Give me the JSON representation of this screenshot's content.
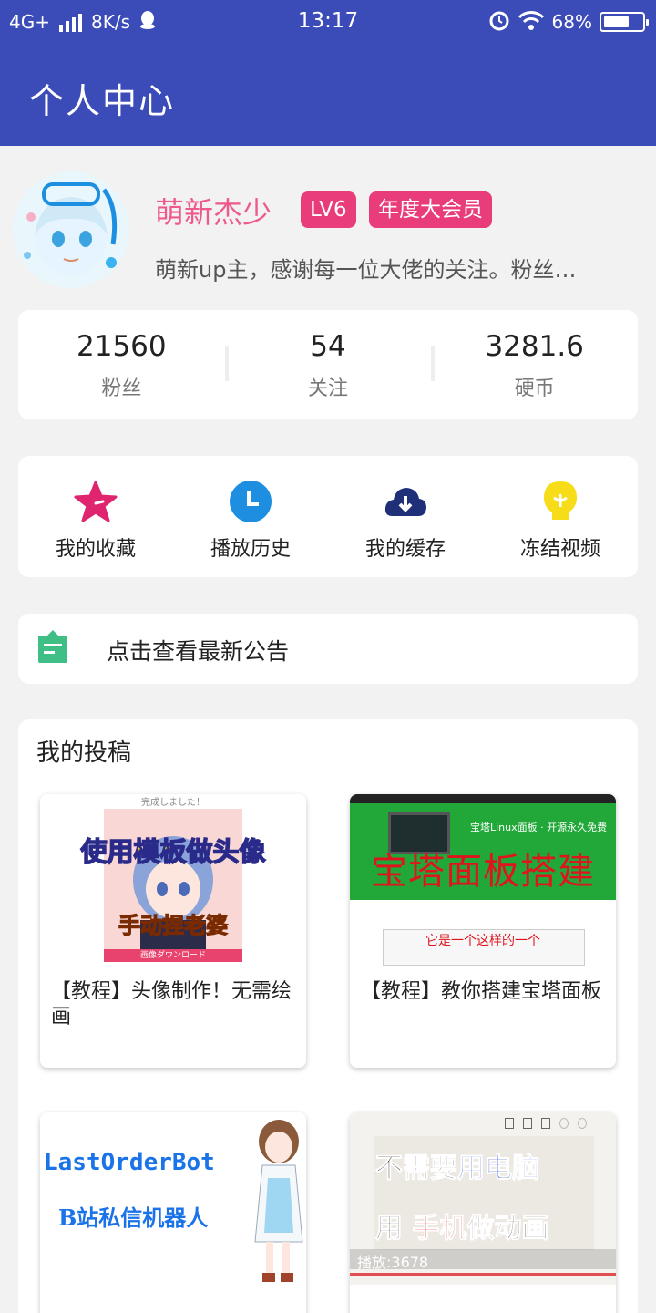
{
  "status_bar": {
    "network": "4G+",
    "speed": "8K/s",
    "time": "13:17",
    "battery": "68%",
    "battery_level": 0.68,
    "icons": [
      "signal-icon",
      "qq-icon",
      "alarm-icon",
      "wifi-icon",
      "battery-icon"
    ]
  },
  "appbar": {
    "title": "个人中心"
  },
  "profile": {
    "username": "萌新杰少",
    "level_badge": "LV6",
    "vip_badge": "年度大会员",
    "bio": "萌新up主，感谢每一位大佬的关注。粉丝…"
  },
  "stats": [
    {
      "value": "21560",
      "label": "粉丝"
    },
    {
      "value": "54",
      "label": "关注"
    },
    {
      "value": "3281.6",
      "label": "硬币"
    }
  ],
  "quick_actions": [
    {
      "label": "我的收藏",
      "icon": "star-icon",
      "color": "#e0256f"
    },
    {
      "label": "播放历史",
      "icon": "clock-icon",
      "color": "#1e8fe0"
    },
    {
      "label": "我的缓存",
      "icon": "cloud-download-icon",
      "color": "#1f2f78"
    },
    {
      "label": "冻结视频",
      "icon": "bulb-icon",
      "color": "#f7dc1a"
    }
  ],
  "notice": {
    "text": "点击查看最新公告",
    "icon": "notice-icon",
    "color": "#3fbf86"
  },
  "posts": {
    "title": "我的投稿",
    "items": [
      {
        "title": "【教程】头像制作！无需绘画",
        "thumb": {
          "top_caption": "完成しました！",
          "headline": "使用模板做头像",
          "sub": "手动捏老婆",
          "button": "画像ダウンロード"
        }
      },
      {
        "title": "【教程】教你搭建宝塔面板",
        "thumb": {
          "banner": "宝塔Linux面板 · 开源永久免费",
          "headline": "宝塔面板搭建",
          "sub": "它是一个这样的一个"
        }
      },
      {
        "title": "",
        "thumb": {
          "headline": "LastOrderBot",
          "sub": "B站私信机器人"
        }
      },
      {
        "title": "",
        "thumb": {
          "line1_a": "不需要",
          "line1_b": "用电脑",
          "line2_a": "用",
          "line2_b": "手机",
          "line2_c": "做动画",
          "footer": "播放:3678"
        }
      }
    ]
  }
}
